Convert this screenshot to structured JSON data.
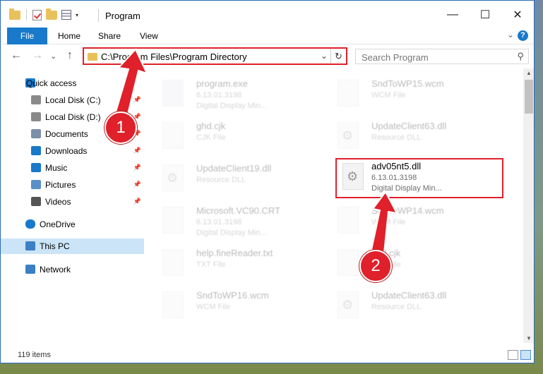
{
  "window": {
    "title": "Program"
  },
  "window_controls": {
    "minimize": "—",
    "maximize": "☐",
    "close": "✕"
  },
  "ribbon": {
    "file": "File",
    "home": "Home",
    "share": "Share",
    "view": "View",
    "expand": "⌄",
    "help": "?"
  },
  "nav": {
    "back": "←",
    "forward": "→",
    "recent": "⌄",
    "up": "↑",
    "address": "C:\\Program Files\\Program Directory",
    "address_dropdown": "⌄",
    "refresh": "↻",
    "search_placeholder": "Search Program",
    "search_icon": "⚲"
  },
  "sidebar": {
    "items": [
      {
        "label": "Quick access",
        "icon": "star-icon"
      },
      {
        "label": "Local Disk (C:)",
        "icon": "drive-icon",
        "pinned": true
      },
      {
        "label": "Local Disk (D:)",
        "icon": "drive-icon",
        "pinned": true
      },
      {
        "label": "Documents",
        "icon": "documents-icon",
        "pinned": true
      },
      {
        "label": "Downloads",
        "icon": "downloads-icon",
        "pinned": true
      },
      {
        "label": "Music",
        "icon": "music-icon",
        "pinned": true
      },
      {
        "label": "Pictures",
        "icon": "pictures-icon",
        "pinned": true
      },
      {
        "label": "Videos",
        "icon": "videos-icon",
        "pinned": true
      },
      {
        "label": "OneDrive",
        "icon": "onedrive-icon"
      },
      {
        "label": "This PC",
        "icon": "computer-icon",
        "selected": true
      },
      {
        "label": "Network",
        "icon": "network-icon"
      }
    ],
    "pin_glyph": "📌"
  },
  "files": {
    "col1": [
      {
        "name": "program.exe",
        "line2": "6.13.01.3198",
        "line3": "Digital Display Min..."
      },
      {
        "name": "ghd.cjk",
        "line2": "CJK File",
        "line3": ""
      },
      {
        "name": "UpdateClient19.dll",
        "line2": "Resource DLL",
        "line3": ""
      },
      {
        "name": "Microsoft.VC90.CRT",
        "line2": "6.13.01.3198",
        "line3": "Digital Display Min..."
      },
      {
        "name": "help.fineReader.txt",
        "line2": "TXT File",
        "line3": ""
      },
      {
        "name": "SndToWP16.wcm",
        "line2": "WCM File",
        "line3": ""
      }
    ],
    "col2": [
      {
        "name": "SndToWP15.wcm",
        "line2": "WCM File",
        "line3": ""
      },
      {
        "name": "UpdateClient63.dll",
        "line2": "Resource DLL",
        "line3": ""
      },
      {
        "name": "adv05nt5.dll",
        "line2": "6.13.01.3198",
        "line3": "Digital Display Min..."
      },
      {
        "name": "SndToWP14.wcm",
        "line2": "WCM File",
        "line3": ""
      },
      {
        "name": "ghd.cjk",
        "line2": "CJK File",
        "line3": ""
      },
      {
        "name": "UpdateClient63.dll",
        "line2": "Resource DLL",
        "line3": ""
      }
    ]
  },
  "status": {
    "count": "119 items"
  },
  "callouts": {
    "one": "1",
    "two": "2"
  },
  "colors": {
    "accent": "#1979ca",
    "highlight": "#e0202a"
  }
}
